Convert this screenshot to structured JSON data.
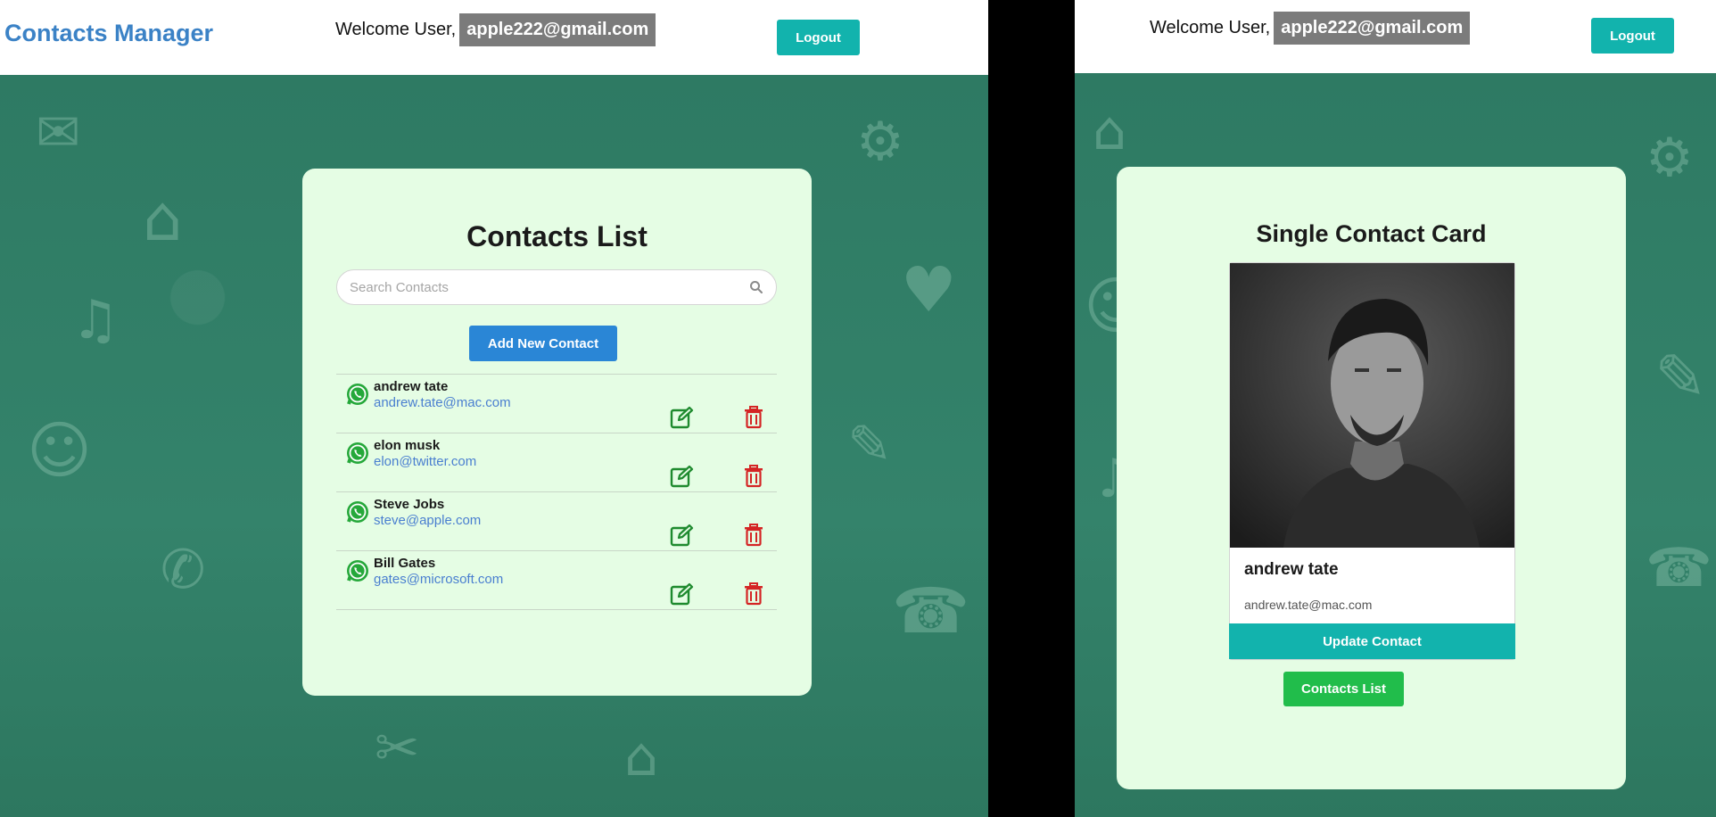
{
  "left": {
    "navbar": {
      "brand": "Contacts Manager",
      "welcome_label": "Welcome User,",
      "user_email": "apple222@gmail.com",
      "logout_label": "Logout"
    },
    "contacts_list": {
      "title": "Contacts List",
      "search_placeholder": "Search Contacts",
      "add_button_label": "Add New Contact",
      "contacts": [
        {
          "name": "andrew tate",
          "email": "andrew.tate@mac.com"
        },
        {
          "name": "elon musk",
          "email": "elon@twitter.com"
        },
        {
          "name": "Steve Jobs",
          "email": "steve@apple.com"
        },
        {
          "name": "Bill Gates",
          "email": "gates@microsoft.com"
        }
      ]
    }
  },
  "right": {
    "navbar": {
      "welcome_label": "Welcome User,",
      "user_email": "apple222@gmail.com",
      "logout_label": "Logout"
    },
    "single_contact": {
      "title": "Single Contact Card",
      "name": "andrew tate",
      "email": "andrew.tate@mac.com",
      "update_button_label": "Update Contact",
      "list_button_label": "Contacts List"
    }
  },
  "colors": {
    "brand": "#3b82c6",
    "teal_button": "#12b3ad",
    "add_button": "#2a86d6",
    "green_button": "#21bd4b",
    "card_bg": "#e5fde4",
    "edit_icon": "#1e8a2e",
    "delete_icon": "#d42424",
    "whatsapp": "#25a83a"
  }
}
